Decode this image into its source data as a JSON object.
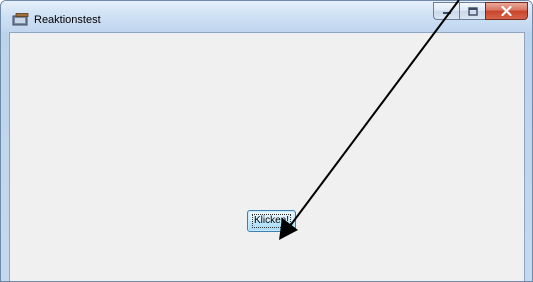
{
  "window": {
    "title": "Reaktionstest",
    "icon": "app-window-icon",
    "controls": [
      "minimize-icon",
      "maximize-icon",
      "close-icon"
    ]
  },
  "main": {
    "button_label": "Klicken!"
  },
  "annotation": {
    "icon": "pointer-arrow"
  },
  "colors": {
    "client_background": "#f0f0f0",
    "button_border": "#3c7fb1",
    "close_button": "#c8432a",
    "annotation_arrow": "#000000"
  }
}
